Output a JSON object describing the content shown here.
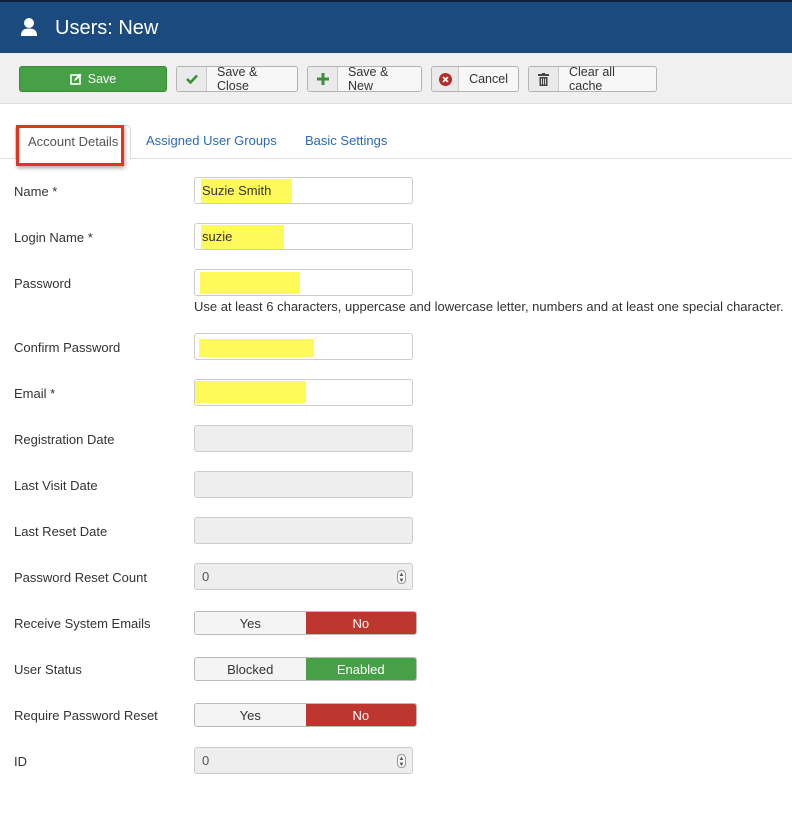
{
  "header": {
    "title": "Users: New",
    "icon": "user-icon"
  },
  "toolbar": {
    "save": {
      "label": "Save",
      "icon": "edit-icon"
    },
    "save_close": {
      "label": "Save & Close",
      "icon": "check-icon"
    },
    "save_new": {
      "label": "Save & New",
      "icon": "plus-icon"
    },
    "cancel": {
      "label": "Cancel",
      "icon": "cancel-circle-icon"
    },
    "clear_cache": {
      "label": "Clear all cache",
      "icon": "trash-icon"
    }
  },
  "colors": {
    "header_bg": "#1a4a7e",
    "success": "#46a046",
    "danger": "#bd362f",
    "link": "#2a69b8",
    "highlight": "#fdfa5a",
    "annotation": "#e8321e"
  },
  "tabs": [
    {
      "label": "Account Details",
      "active": true
    },
    {
      "label": "Assigned User Groups",
      "active": false
    },
    {
      "label": "Basic Settings",
      "active": false
    }
  ],
  "form": {
    "name": {
      "label": "Name *",
      "value": "Suzie Smith"
    },
    "login_name": {
      "label": "Login Name *",
      "value": "suzie"
    },
    "password": {
      "label": "Password",
      "value": "",
      "help": "Use at least 6 characters, uppercase and lowercase letter, numbers and at least one special character."
    },
    "confirm_password": {
      "label": "Confirm Password",
      "value": ""
    },
    "email": {
      "label": "Email *",
      "value": ""
    },
    "registration_date": {
      "label": "Registration Date",
      "value": ""
    },
    "last_visit_date": {
      "label": "Last Visit Date",
      "value": ""
    },
    "last_reset_date": {
      "label": "Last Reset Date",
      "value": ""
    },
    "password_reset_count": {
      "label": "Password Reset Count",
      "value": "0"
    },
    "receive_system_emails": {
      "label": "Receive System Emails",
      "options": [
        "Yes",
        "No"
      ],
      "selected": "No"
    },
    "user_status": {
      "label": "User Status",
      "options": [
        "Blocked",
        "Enabled"
      ],
      "selected": "Enabled"
    },
    "require_password_reset": {
      "label": "Require Password Reset",
      "options": [
        "Yes",
        "No"
      ],
      "selected": "No"
    },
    "id": {
      "label": "ID",
      "value": "0"
    }
  }
}
